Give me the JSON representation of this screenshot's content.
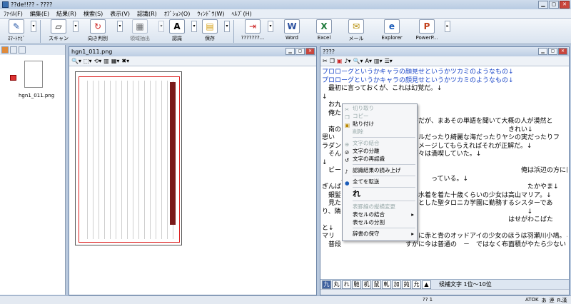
{
  "app": {
    "title": "??de!!?? - ????"
  },
  "menu": [
    "ﾌｧｲﾙ(F)",
    "編集(E)",
    "結果(R)",
    "検索(S)",
    "表示(V)",
    "認識(R)",
    "ｵﾌﾟｼｮﾝ(O)",
    "ｳｨﾝﾄﾞｳ(W)",
    "ﾍﾙﾌﾟ(H)"
  ],
  "toolbar": [
    {
      "label": "ｽﾏｰﾄﾅﾋﾞ",
      "icon": "smart-navi-icon",
      "glyph": "✎"
    },
    {
      "label": "スキャン",
      "icon": "scanner-icon",
      "glyph": "▱"
    },
    {
      "label": "向き判別",
      "icon": "rotate-icon",
      "glyph": "↻"
    },
    {
      "label": "領域抽出",
      "icon": "region-icon",
      "glyph": "▦"
    },
    {
      "label": "認識",
      "icon": "recognize-icon",
      "glyph": "A"
    },
    {
      "label": "保存",
      "icon": "save-folder-icon",
      "glyph": "▤"
    },
    {
      "label": "???????...",
      "icon": "export-icon",
      "glyph": "⇥"
    },
    {
      "label": "Word",
      "icon": "word-icon",
      "glyph": "W"
    },
    {
      "label": "Excel",
      "icon": "excel-icon",
      "glyph": "X"
    },
    {
      "label": "メール",
      "icon": "mail-icon",
      "glyph": "✉"
    },
    {
      "label": "Explorer",
      "icon": "explorer-icon",
      "glyph": "e"
    },
    {
      "label": "PowerP...",
      "icon": "powerpoint-icon",
      "glyph": "P"
    }
  ],
  "thumbnail": {
    "label": "hgn1_011.png"
  },
  "imagewin": {
    "title": "hgn1_011.png"
  },
  "textwin": {
    "title": "????"
  },
  "lines": [
    "プロローグというかキャラの顔見せというかツカミのようなもの↓",
    "プロローグというかキャラの顔見せというかツカミのようなもの↓",
    "　最初に言っておくが、これは幻覚だ。↓",
    "↓",
    "　お九",
    "　俺た",
    "　　　　　　　　　　　　あるのだが、まあその単語を聞いて大概の人が漠然と",
    "　南の　　　　　　　　　　　　　　　　　　　　　　　　　　きれい↓",
    "思い　　　　　　　　　　　ピカルだったり綺麗な海だったりヤシの実だったりフ",
    "ラダン　　　　　　　　　　をイメージしてもらえればそれが正解だ。↓",
    "　そん　　　　　　　　　　の面々は満喫していた。↓",
    "↓",
    "　ビー　　　　　　　　　　　　　　　　　　　　　　　　　　　　俺は浜辺の方に目をやる。↓",
    "　　　二人　　　　　　　　　　　　っている。↓",
    "ぎんば　　　　　　　　　　　　　　　　　　　　　　　　　　　　　たかやま↓",
    "　銀髪　　　　　　　　　クール水着を着た十歳くらいの少女は高山マリア。↓",
    "　見た　　　　　　　　　れっきとした聖タロニカ学園に勤務するシスターであ",
    "り、隣　　　　　　　　　　　　　　　　　　　　　　　　　　　　　↓",
    "　　　　　　　　　　　　　　　　　　　　　　　　　　　　　はせがわこばた",
    "と↓",
    "マリ　　　　　　　　　　　　　に赤と青のオッドアイの少女のほうは羽瀬川小鳩。↓",
    "　普段　　　　　　　　　　すがに今は普通の　－　ではなく布面積がやたら少ない"
  ],
  "contextmenu": [
    {
      "label": "切り取り",
      "disabled": true,
      "icon": "scissors-icon"
    },
    {
      "label": "コピー",
      "disabled": true,
      "icon": "copy-icon"
    },
    {
      "label": "貼り付け",
      "disabled": false,
      "icon": "paste-icon"
    },
    {
      "label": "削除",
      "disabled": true,
      "icon": ""
    },
    {
      "sep": true
    },
    {
      "label": "文字の結合",
      "disabled": true,
      "icon": "join-icon"
    },
    {
      "label": "文字の分離",
      "disabled": false,
      "icon": "split-icon"
    },
    {
      "label": "文字の再認識",
      "disabled": false,
      "icon": "rerecognize-icon"
    },
    {
      "sep": true
    },
    {
      "label": "認識結果の読み上げ",
      "disabled": false,
      "icon": "speech-icon"
    },
    {
      "sep": true
    },
    {
      "label": "全てを転送",
      "disabled": false,
      "icon": "transfer-icon"
    },
    {
      "sep": true
    },
    {
      "label": "れ",
      "big": true
    },
    {
      "sep": true
    },
    {
      "label": "表罫線の縦横変更",
      "disabled": true
    },
    {
      "label": "表セルの結合",
      "disabled": false,
      "submenu": true
    },
    {
      "label": "表セルの分割",
      "disabled": false
    },
    {
      "sep": true
    },
    {
      "label": "辞書の保守",
      "disabled": false,
      "submenu": true
    }
  ],
  "candidates": [
    "九",
    "丸",
    "れ",
    "馳",
    "机",
    "鼠",
    "軋",
    "加",
    "鈍",
    "允"
  ],
  "candidate_info": "候補文字 1位〜10位",
  "status": {
    "left": "?? 1",
    "ime": [
      "ATOK",
      "あ",
      "連",
      "R.漢"
    ]
  }
}
